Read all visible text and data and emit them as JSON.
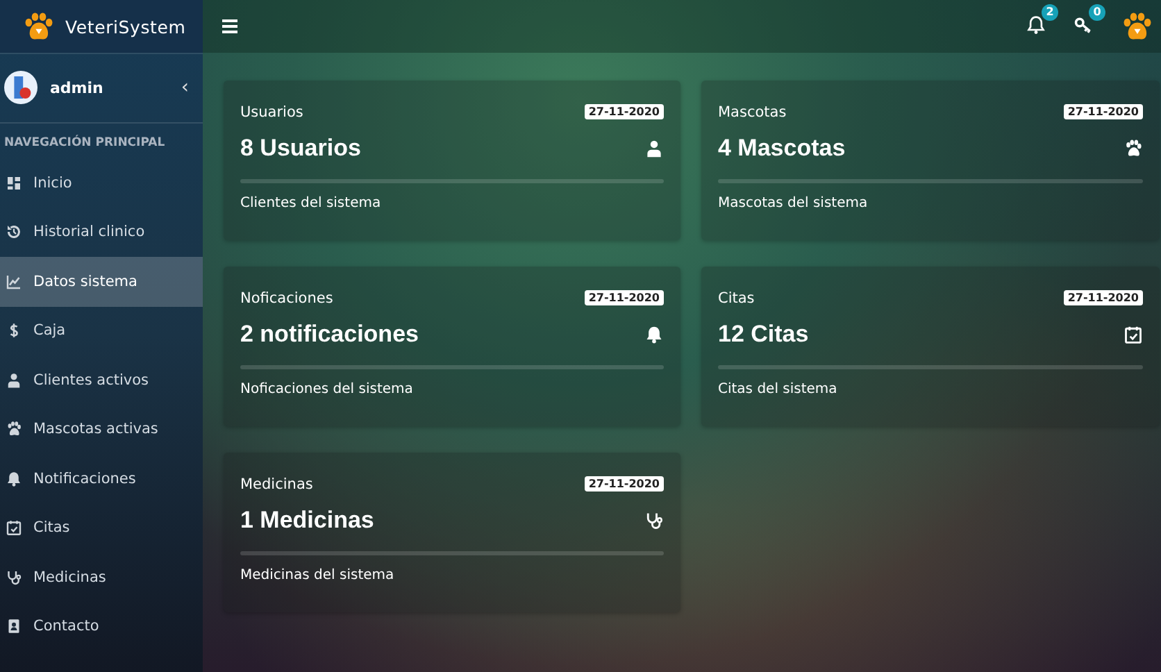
{
  "brand": {
    "title": "VeteriSystem"
  },
  "header": {
    "notifications": {
      "count": "2"
    },
    "keys": {
      "count": "0"
    }
  },
  "user": {
    "name": "admin",
    "toggle": "‹"
  },
  "sidebar": {
    "heading": "NAVEGACIÓN PRINCIPAL",
    "items": [
      {
        "label": "Inicio",
        "kind": "dashboard",
        "selected": false
      },
      {
        "label": "Historial clinico",
        "kind": "history",
        "selected": false
      },
      {
        "label": "Datos sistema",
        "kind": "chart",
        "selected": true
      },
      {
        "label": "Caja",
        "kind": "dollar",
        "selected": false
      },
      {
        "label": "Clientes activos",
        "kind": "user",
        "selected": false
      },
      {
        "label": "Mascotas activas",
        "kind": "paw",
        "selected": false
      },
      {
        "label": "Notificaciones",
        "kind": "bell",
        "selected": false
      },
      {
        "label": "Citas",
        "kind": "calendar",
        "selected": false
      },
      {
        "label": "Medicinas",
        "kind": "stethoscope",
        "selected": false
      },
      {
        "label": "Contacto",
        "kind": "contact",
        "selected": false
      }
    ]
  },
  "cards": [
    {
      "title": "Usuarios",
      "date": "27-11-2020",
      "value": "8 Usuarios",
      "kind": "user",
      "footer": "Clientes del sistema"
    },
    {
      "title": "Mascotas",
      "date": "27-11-2020",
      "value": "4 Mascotas",
      "kind": "paw",
      "footer": "Mascotas del sistema"
    },
    {
      "title": "Noficaciones",
      "date": "27-11-2020",
      "value": "2 notificaciones",
      "kind": "bell",
      "footer": "Noficaciones del sistema"
    },
    {
      "title": "Citas",
      "date": "27-11-2020",
      "value": "12 Citas",
      "kind": "calendar",
      "footer": "Citas del sistema"
    },
    {
      "title": "Medicinas",
      "date": "27-11-2020",
      "value": "1 Medicinas",
      "kind": "stethoscope",
      "footer": "Medicinas del sistema"
    }
  ]
}
